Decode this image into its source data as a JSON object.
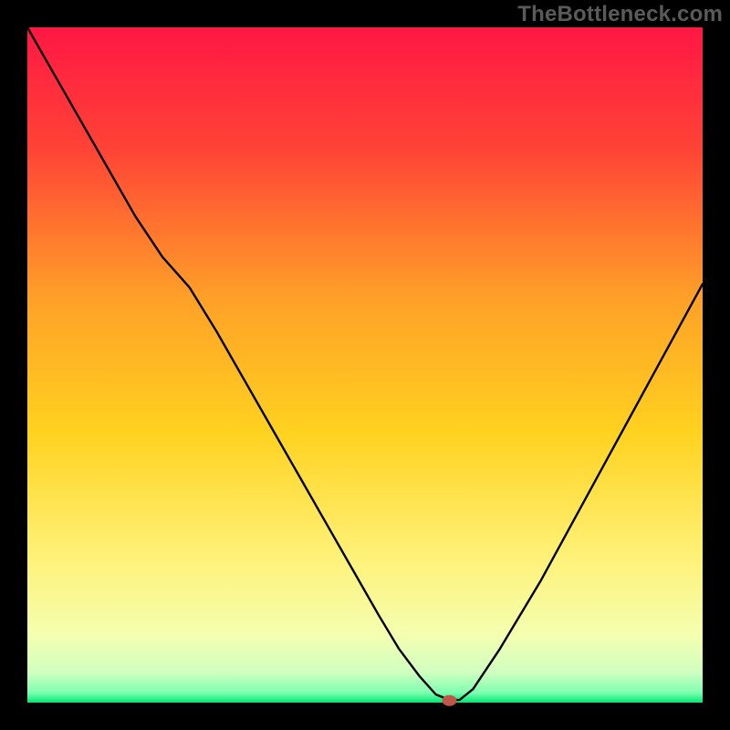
{
  "watermark": "TheBottleneck.com",
  "chart_data": {
    "type": "line",
    "title": "",
    "xlabel": "",
    "ylabel": "",
    "xlim": [
      0,
      100
    ],
    "ylim": [
      0,
      100
    ],
    "grid": false,
    "legend": false,
    "gradient_stops": [
      {
        "offset": 0.0,
        "color": "#ff1744"
      },
      {
        "offset": 0.18,
        "color": "#ff4336"
      },
      {
        "offset": 0.4,
        "color": "#ffa028"
      },
      {
        "offset": 0.6,
        "color": "#ffd21f"
      },
      {
        "offset": 0.78,
        "color": "#fff176"
      },
      {
        "offset": 0.9,
        "color": "#f4ffb0"
      },
      {
        "offset": 0.955,
        "color": "#d0ffc0"
      },
      {
        "offset": 0.985,
        "color": "#7fffb0"
      },
      {
        "offset": 1.0,
        "color": "#00e676"
      }
    ],
    "series": [
      {
        "name": "bottleneck-curve",
        "x": [
          0.0,
          4,
          8,
          12,
          16,
          20,
          24,
          28,
          32,
          36,
          40,
          44,
          48,
          52,
          55,
          58,
          60.5,
          62.5,
          64,
          66,
          70,
          76,
          82,
          88,
          94,
          100
        ],
        "y": [
          100,
          93,
          86,
          79,
          72,
          66,
          61.5,
          55,
          48,
          41,
          34,
          27,
          20,
          13,
          8,
          4,
          1.2,
          0.4,
          0.4,
          2,
          8,
          18,
          29,
          40,
          51,
          62
        ]
      }
    ],
    "marker": {
      "x": 62.5,
      "y": 0.3,
      "color": "#c0564a",
      "rx": 8,
      "ry": 6
    },
    "frame_inset": 30
  }
}
